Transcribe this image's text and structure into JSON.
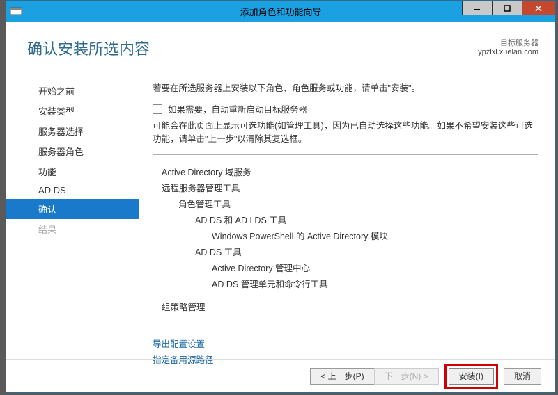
{
  "titlebar": {
    "title": "添加角色和功能向导"
  },
  "header": {
    "page_title": "确认安装所选内容",
    "dest_label": "目标服务器",
    "dest_value": "ypzlxl.xuelan.com"
  },
  "sidebar": {
    "items": [
      {
        "label": "开始之前"
      },
      {
        "label": "安装类型"
      },
      {
        "label": "服务器选择"
      },
      {
        "label": "服务器角色"
      },
      {
        "label": "功能"
      },
      {
        "label": "AD DS"
      },
      {
        "label": "确认"
      },
      {
        "label": "结果"
      }
    ]
  },
  "main": {
    "intro": "若要在所选服务器上安装以下角色、角色服务或功能，请单击\"安装\"。",
    "checkbox_label": "如果需要，自动重新启动目标服务器",
    "note": "可能会在此页面上显示可选功能(如管理工具)，因为已自动选择这些功能。如果不希望安装这些可选功能，请单击\"上一步\"以清除其复选框。",
    "tree": {
      "l0a": "Active Directory 域服务",
      "l0b": "远程服务器管理工具",
      "l1a": "角色管理工具",
      "l2a": "AD DS 和 AD LDS 工具",
      "l3a": "Windows PowerShell 的 Active Directory 模块",
      "l2b": "AD DS 工具",
      "l3b": "Active Directory 管理中心",
      "l3c": "AD DS 管理单元和命令行工具",
      "l0c": "组策略管理"
    },
    "link_export": "导出配置设置",
    "link_altsrc": "指定备用源路径"
  },
  "footer": {
    "prev": "< 上一步(P)",
    "next": "下一步(N) >",
    "install": "安装(I)",
    "cancel": "取消"
  }
}
